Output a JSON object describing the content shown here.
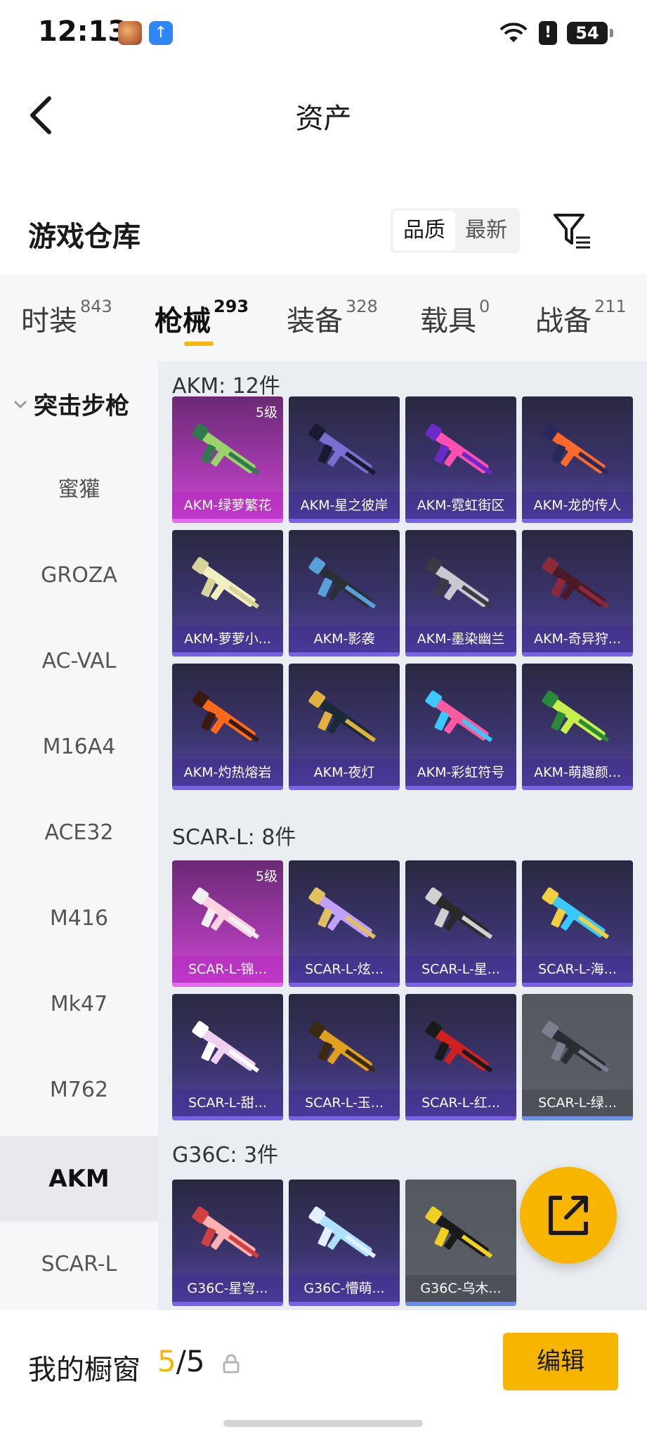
{
  "status_bar": {
    "time": "12:13",
    "battery": "54",
    "alert": "!"
  },
  "header": {
    "title": "资产"
  },
  "warehouse": {
    "title": "游戏仓库",
    "sort": {
      "quality": "品质",
      "newest": "最新",
      "selected": "品质"
    }
  },
  "tabs": [
    {
      "label": "时装",
      "count": "843",
      "active": false
    },
    {
      "label": "枪械",
      "count": "293",
      "active": true
    },
    {
      "label": "装备",
      "count": "328",
      "active": false
    },
    {
      "label": "载具",
      "count": "0",
      "active": false
    },
    {
      "label": "战备",
      "count": "211",
      "active": false
    }
  ],
  "sidebar": {
    "group": "突击步枪",
    "items": [
      "蜜獾",
      "GROZA",
      "AC-VAL",
      "M16A4",
      "ACE32",
      "M416",
      "Mk47",
      "M762",
      "AKM",
      "SCAR-L"
    ],
    "active": "AKM"
  },
  "sections": [
    {
      "title": "AKM: 12件",
      "items": [
        {
          "name": "AKM-绿萝繁花",
          "level": "5级",
          "rarity": "legend"
        },
        {
          "name": "AKM-星之彼岸",
          "rarity": "epic"
        },
        {
          "name": "AKM-霓虹街区",
          "rarity": "epic"
        },
        {
          "name": "AKM-龙的传人",
          "rarity": "epic"
        },
        {
          "name": "AKM-萝萝小...",
          "rarity": "epic"
        },
        {
          "name": "AKM-影袭",
          "rarity": "epic"
        },
        {
          "name": "AKM-墨染幽兰",
          "rarity": "epic"
        },
        {
          "name": "AKM-奇异狩...",
          "rarity": "epic"
        },
        {
          "name": "AKM-灼热熔岩",
          "rarity": "epic"
        },
        {
          "name": "AKM-夜灯",
          "rarity": "epic"
        },
        {
          "name": "AKM-彩虹符号",
          "rarity": "epic"
        },
        {
          "name": "AKM-萌趣颜...",
          "rarity": "epic"
        }
      ]
    },
    {
      "title": "SCAR-L: 8件",
      "items": [
        {
          "name": "SCAR-L-锦...",
          "level": "5级",
          "rarity": "legend"
        },
        {
          "name": "SCAR-L-炫...",
          "rarity": "epic"
        },
        {
          "name": "SCAR-L-星...",
          "rarity": "epic"
        },
        {
          "name": "SCAR-L-海...",
          "rarity": "epic"
        },
        {
          "name": "SCAR-L-甜...",
          "rarity": "epic"
        },
        {
          "name": "SCAR-L-玉...",
          "rarity": "epic"
        },
        {
          "name": "SCAR-L-红...",
          "rarity": "epic"
        },
        {
          "name": "SCAR-L-绿...",
          "rarity": "grey"
        }
      ]
    },
    {
      "title": "G36C: 3件",
      "items": [
        {
          "name": "G36C-星穹...",
          "rarity": "epic"
        },
        {
          "name": "G36C-懵萌...",
          "rarity": "epic"
        },
        {
          "name": "G36C-乌木...",
          "rarity": "grey"
        }
      ]
    }
  ],
  "showcase": {
    "label": "我的橱窗",
    "current": "5",
    "total": "/5",
    "edit_label": "编辑"
  },
  "colors": {
    "accent": "#f7b500",
    "legend": "#c04ac8",
    "epic": "#4a3f8f",
    "grey": "#5a5d64"
  },
  "icons": {
    "back": "back-arrow-icon",
    "filter": "filter-icon",
    "share": "share-external-icon",
    "lock": "lock-icon"
  }
}
